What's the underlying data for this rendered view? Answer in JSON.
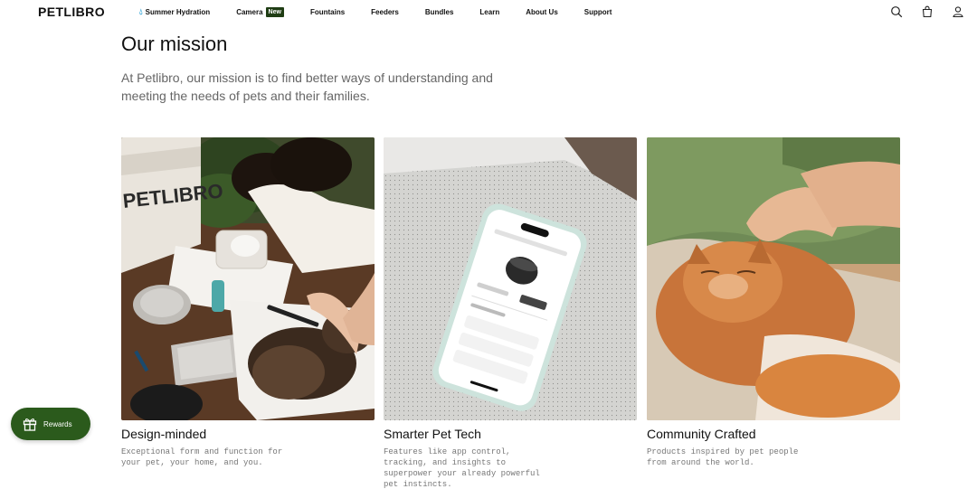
{
  "header": {
    "logo": "PETLIBRO",
    "nav": [
      {
        "label": "Summer Hydration",
        "icon": "water-drops-icon"
      },
      {
        "label": "Camera",
        "badge": "New"
      },
      {
        "label": "Fountains"
      },
      {
        "label": "Feeders"
      },
      {
        "label": "Bundles"
      },
      {
        "label": "Learn"
      },
      {
        "label": "About Us"
      },
      {
        "label": "Support"
      }
    ],
    "icons": [
      "search-icon",
      "cart-icon",
      "account-icon"
    ]
  },
  "mission": {
    "title": "Our mission",
    "text": "At Petlibro, our mission is to find better ways of understanding and meeting the needs of pets and their families."
  },
  "cards": [
    {
      "title": "Design-minded",
      "description": "Exceptional form and function for your pet, your home, and you.",
      "image": "woman-designing-pet-products-with-cat-photo",
      "box_text": "PETLIBRO"
    },
    {
      "title": "Smarter Pet Tech",
      "description": "Features like app control, tracking, and insights to superpower your already powerful pet instincts.",
      "image": "smartphone-app-on-fabric-photo"
    },
    {
      "title": "Community Crafted",
      "description": "Products inspired by pet people from around the world.",
      "image": "hand-petting-orange-cat-photo"
    }
  ],
  "rewards": {
    "label": "Rewards",
    "icon": "gift-icon"
  },
  "colors": {
    "brand_green": "#2b5a1c",
    "badge_green": "#1f3d14",
    "summer_blue": "#2fa3d6",
    "text_gray": "#666666"
  }
}
